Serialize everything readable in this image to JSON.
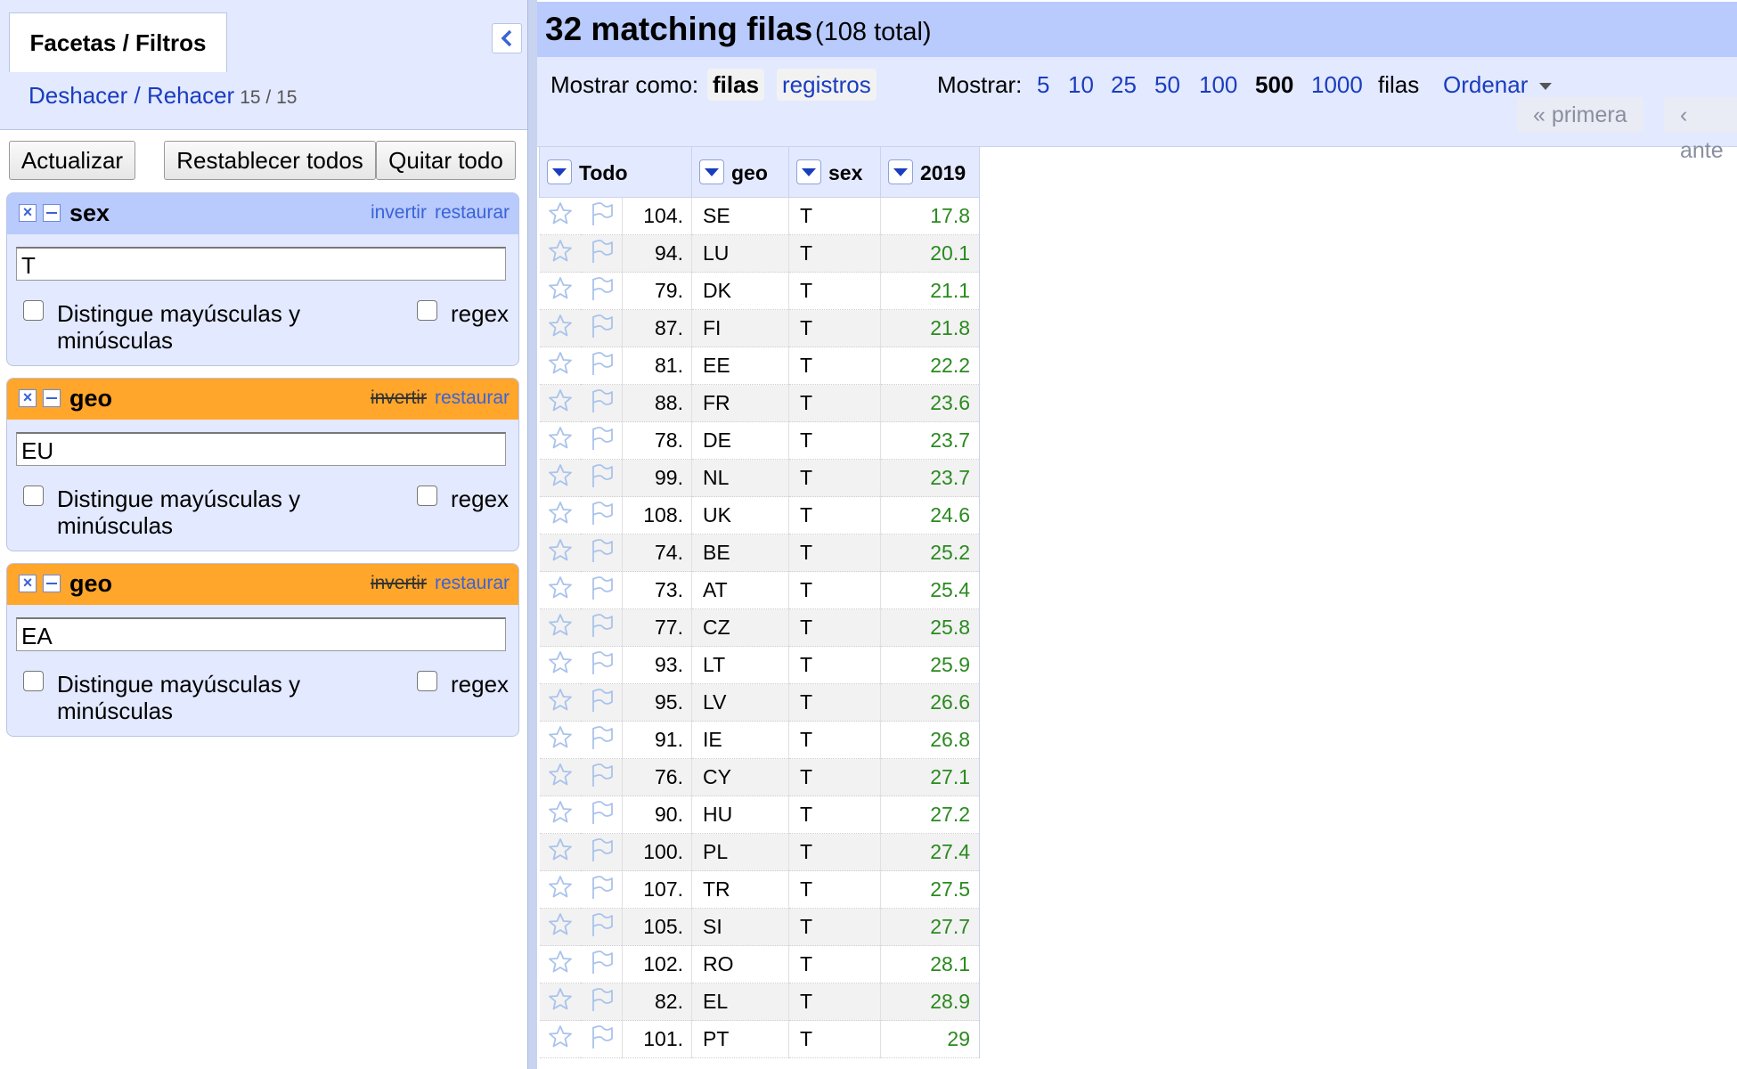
{
  "left_panel": {
    "tab_label": "Facetas / Filtros",
    "undo_label": "Deshacer / Rehacer",
    "undo_count": "15 / 15",
    "buttons": {
      "refresh": "Actualizar",
      "reset_all": "Restablecer todos",
      "remove_all": "Quitar todo"
    },
    "facets": [
      {
        "title": "sex",
        "invert_label": "invertir",
        "restore_label": "restaurar",
        "value": "T",
        "case_label": "Distingue mayúsculas y minúsculas",
        "regex_label": "regex",
        "color": "#b9cafc"
      },
      {
        "title": "geo",
        "invert_label": "invertir",
        "restore_label": "restaurar",
        "value": "EU",
        "case_label": "Distingue mayúsculas y minúsculas",
        "regex_label": "regex",
        "color": "#ffa62b"
      },
      {
        "title": "geo",
        "invert_label": "invertir",
        "restore_label": "restaurar",
        "value": "EA",
        "case_label": "Distingue mayúsculas y minúsculas",
        "regex_label": "regex",
        "color": "#ffa62b"
      }
    ]
  },
  "header": {
    "match_count": "32 matching filas",
    "total": "(108 total)"
  },
  "toolbar": {
    "show_as_label": "Mostrar como:",
    "view_rows": "filas",
    "view_records": "registros",
    "show_label": "Mostrar:",
    "page_sizes": [
      "5",
      "10",
      "25",
      "50",
      "100",
      "500",
      "1000"
    ],
    "selected_page_size": "500",
    "rows_label": "filas",
    "sort_label": "Ordenar",
    "first_label": "« primera",
    "prev_label": "‹ ante"
  },
  "table": {
    "columns": [
      "Todo",
      "geo",
      "sex",
      "2019"
    ],
    "rows": [
      {
        "idx": "104.",
        "geo": "SE",
        "sex": "T",
        "val": "17.8"
      },
      {
        "idx": "94.",
        "geo": "LU",
        "sex": "T",
        "val": "20.1"
      },
      {
        "idx": "79.",
        "geo": "DK",
        "sex": "T",
        "val": "21.1"
      },
      {
        "idx": "87.",
        "geo": "FI",
        "sex": "T",
        "val": "21.8"
      },
      {
        "idx": "81.",
        "geo": "EE",
        "sex": "T",
        "val": "22.2"
      },
      {
        "idx": "88.",
        "geo": "FR",
        "sex": "T",
        "val": "23.6"
      },
      {
        "idx": "78.",
        "geo": "DE",
        "sex": "T",
        "val": "23.7"
      },
      {
        "idx": "99.",
        "geo": "NL",
        "sex": "T",
        "val": "23.7"
      },
      {
        "idx": "108.",
        "geo": "UK",
        "sex": "T",
        "val": "24.6"
      },
      {
        "idx": "74.",
        "geo": "BE",
        "sex": "T",
        "val": "25.2"
      },
      {
        "idx": "73.",
        "geo": "AT",
        "sex": "T",
        "val": "25.4"
      },
      {
        "idx": "77.",
        "geo": "CZ",
        "sex": "T",
        "val": "25.8"
      },
      {
        "idx": "93.",
        "geo": "LT",
        "sex": "T",
        "val": "25.9"
      },
      {
        "idx": "95.",
        "geo": "LV",
        "sex": "T",
        "val": "26.6"
      },
      {
        "idx": "91.",
        "geo": "IE",
        "sex": "T",
        "val": "26.8"
      },
      {
        "idx": "76.",
        "geo": "CY",
        "sex": "T",
        "val": "27.1"
      },
      {
        "idx": "90.",
        "geo": "HU",
        "sex": "T",
        "val": "27.2"
      },
      {
        "idx": "100.",
        "geo": "PL",
        "sex": "T",
        "val": "27.4"
      },
      {
        "idx": "107.",
        "geo": "TR",
        "sex": "T",
        "val": "27.5"
      },
      {
        "idx": "105.",
        "geo": "SI",
        "sex": "T",
        "val": "27.7"
      },
      {
        "idx": "102.",
        "geo": "RO",
        "sex": "T",
        "val": "28.1"
      },
      {
        "idx": "82.",
        "geo": "EL",
        "sex": "T",
        "val": "28.9"
      },
      {
        "idx": "101.",
        "geo": "PT",
        "sex": "T",
        "val": "29"
      }
    ]
  },
  "colors": {
    "accent_blue": "#b9cafc",
    "panel_bg": "#e3e9ff",
    "facet_orange": "#ffa62b",
    "link_blue": "#1a3dbf",
    "value_green": "#2a8a1f"
  }
}
